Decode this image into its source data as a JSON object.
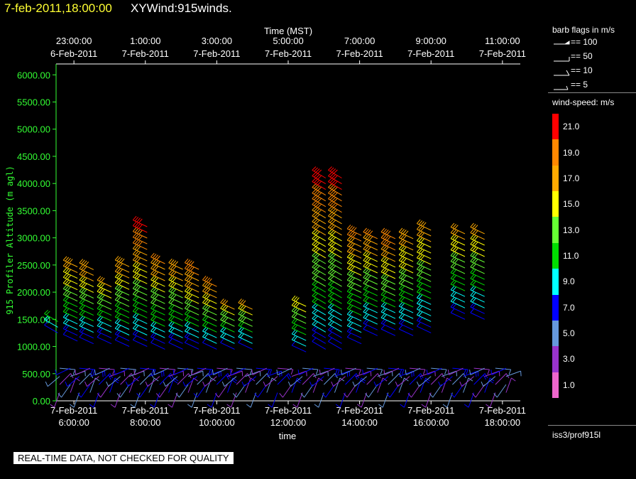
{
  "header": {
    "date": "7-feb-2011,18:00:00",
    "title": "XYWind:915winds."
  },
  "quality_banner": "REAL-TIME DATA, NOT CHECKED FOR QUALITY",
  "legend": {
    "barb_title": "barb flags in m/s",
    "barb_items": [
      "== 100",
      "== 50",
      "== 10",
      "== 5"
    ],
    "speed_title": "wind-speed: m/s",
    "station": "iss3/prof915l"
  },
  "colors": {
    "y_axis_text": "#33ff33",
    "header_date": "#ffff33"
  },
  "chart_data": {
    "type": "wind-barb",
    "top_axis_title": "Time (MST)",
    "top_ticks": [
      [
        "23:00:00",
        "6-Feb-2011"
      ],
      [
        "1:00:00",
        "7-Feb-2011"
      ],
      [
        "3:00:00",
        "7-Feb-2011"
      ],
      [
        "5:00:00",
        "7-Feb-2011"
      ],
      [
        "7:00:00",
        "7-Feb-2011"
      ],
      [
        "9:00:00",
        "7-Feb-2011"
      ],
      [
        "11:00:00",
        "7-Feb-2011"
      ]
    ],
    "bottom_axis_title": "time",
    "bottom_ticks": [
      [
        "7-Feb-2011",
        "6:00:00"
      ],
      [
        "7-Feb-2011",
        "8:00:00"
      ],
      [
        "7-Feb-2011",
        "10:00:00"
      ],
      [
        "7-Feb-2011",
        "12:00:00"
      ],
      [
        "7-Feb-2011",
        "14:00:00"
      ],
      [
        "7-Feb-2011",
        "16:00:00"
      ],
      [
        "7-Feb-2011",
        "18:00:00"
      ]
    ],
    "ylabel": "915 Profiler Altitude (m agl)",
    "y_ticks": [
      "0.00",
      "500.00",
      "1000.00",
      "1500.00",
      "2000.00",
      "2500.00",
      "3000.00",
      "3500.00",
      "4000.00",
      "4500.00",
      "5000.00",
      "5500.00",
      "6000.00"
    ],
    "xlim": [
      5.5,
      18.5
    ],
    "ylim": [
      0,
      6200
    ],
    "colorbar": {
      "labels": [
        "21.0",
        "19.0",
        "17.0",
        "15.0",
        "13.0",
        "11.0",
        "9.0",
        "7.0",
        "5.0",
        "3.0",
        "1.0"
      ],
      "colors": [
        "#ff0000",
        "#ff8800",
        "#ffaa00",
        "#ffff00",
        "#66ff33",
        "#00dd00",
        "#00ffff",
        "#0000ff",
        "#6699dd",
        "#9933cc",
        "#ee66cc"
      ]
    },
    "profiles": [
      {
        "time": 5.55,
        "top": 1500,
        "upper_speed": 12,
        "upper_dir": 300,
        "bottom": 1250
      },
      {
        "time": 6.1,
        "top": 2520,
        "upper_speed": 18,
        "upper_dir": 295,
        "bottom": 1100
      },
      {
        "time": 6.55,
        "top": 2450,
        "upper_speed": 18,
        "upper_dir": 295,
        "bottom": 1050
      },
      {
        "time": 7.05,
        "top": 2200,
        "upper_speed": 17,
        "upper_dir": 295,
        "bottom": 1050
      },
      {
        "time": 7.55,
        "top": 2500,
        "upper_speed": 18,
        "upper_dir": 295,
        "bottom": 1000
      },
      {
        "time": 8.05,
        "top": 3250,
        "upper_speed": 21,
        "upper_dir": 295,
        "bottom": 1000
      },
      {
        "time": 8.55,
        "top": 2600,
        "upper_speed": 19,
        "upper_dir": 295,
        "bottom": 950
      },
      {
        "time": 9.05,
        "top": 2450,
        "upper_speed": 18,
        "upper_dir": 295,
        "bottom": 950
      },
      {
        "time": 9.5,
        "top": 2450,
        "upper_speed": 20,
        "upper_dir": 295,
        "bottom": 950
      },
      {
        "time": 10.0,
        "top": 2200,
        "upper_speed": 20,
        "upper_dir": 295,
        "bottom": 950
      },
      {
        "time": 10.5,
        "top": 1700,
        "upper_speed": 17,
        "upper_dir": 295,
        "bottom": 950
      },
      {
        "time": 11.0,
        "top": 1700,
        "upper_speed": 17,
        "upper_dir": 295,
        "bottom": 950
      },
      {
        "time": 12.5,
        "top": 1800,
        "upper_speed": 16,
        "upper_dir": 295,
        "bottom": 900
      },
      {
        "time": 13.05,
        "top": 4100,
        "upper_speed": 21,
        "upper_dir": 300,
        "bottom": 950
      },
      {
        "time": 13.5,
        "top": 4100,
        "upper_speed": 21,
        "upper_dir": 300,
        "bottom": 950
      },
      {
        "time": 14.05,
        "top": 3100,
        "upper_speed": 19,
        "upper_dir": 295,
        "bottom": 1050
      },
      {
        "time": 14.5,
        "top": 3050,
        "upper_speed": 19,
        "upper_dir": 295,
        "bottom": 1200
      },
      {
        "time": 15.0,
        "top": 3050,
        "upper_speed": 20,
        "upper_dir": 295,
        "bottom": 1200
      },
      {
        "time": 15.5,
        "top": 3000,
        "upper_speed": 18,
        "upper_dir": 295,
        "bottom": 1200
      },
      {
        "time": 16.0,
        "top": 3200,
        "upper_speed": 18,
        "upper_dir": 295,
        "bottom": 1250
      },
      {
        "time": 16.95,
        "top": 3100,
        "upper_speed": 17,
        "upper_dir": 295,
        "bottom": 1500
      },
      {
        "time": 17.5,
        "top": 3100,
        "upper_speed": 17,
        "upper_dir": 295,
        "bottom": 1500
      }
    ],
    "low_level_times": [
      5.6,
      5.9,
      6.15,
      6.45,
      6.7,
      7.0,
      7.3,
      7.55,
      7.85,
      8.1,
      8.4,
      8.65,
      8.9,
      9.2,
      9.45,
      9.7,
      10.0,
      10.3,
      10.55,
      10.8,
      11.1,
      11.4,
      11.7,
      12.1,
      12.4,
      12.7,
      13.0,
      13.3,
      13.6,
      13.9,
      14.2,
      14.5,
      14.8,
      15.1,
      15.4,
      15.7,
      16.0,
      16.3,
      16.6,
      16.9,
      17.2,
      17.5,
      17.8,
      18.1
    ]
  }
}
